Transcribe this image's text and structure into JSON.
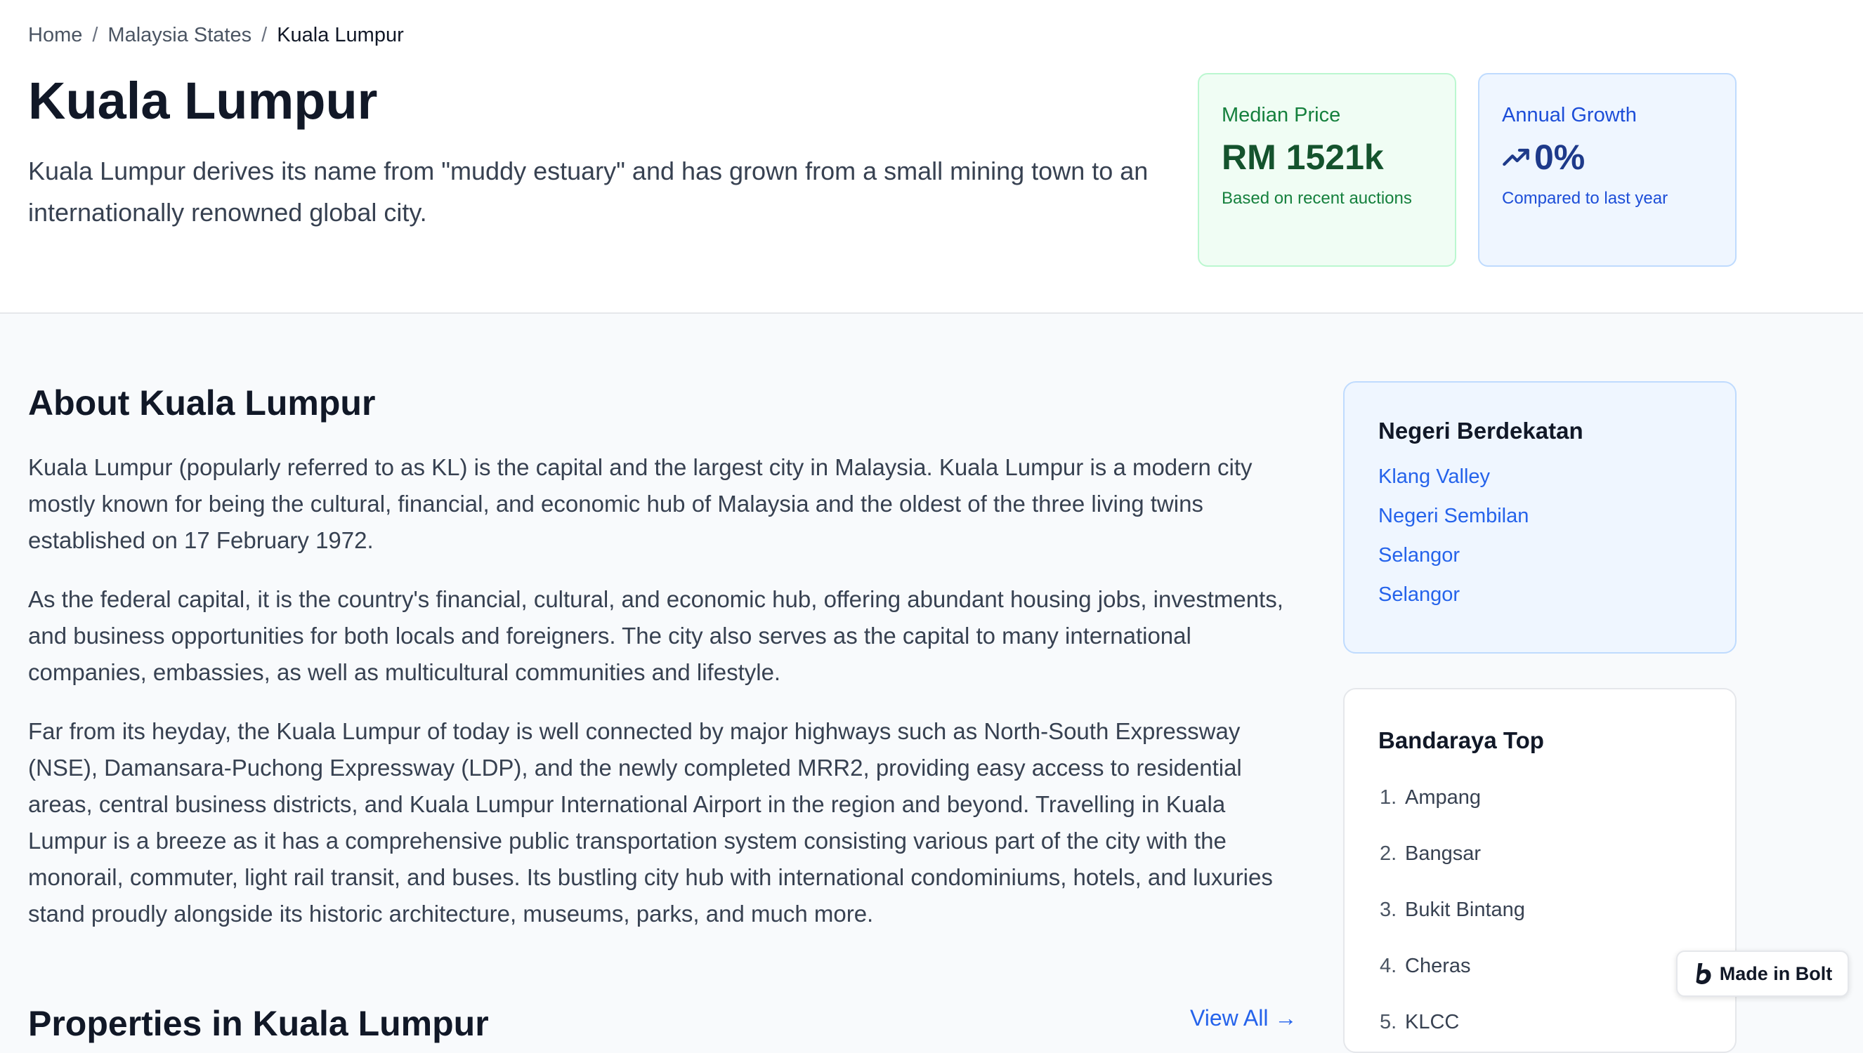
{
  "breadcrumb": {
    "home": "Home",
    "states": "Malaysia States",
    "current": "Kuala Lumpur",
    "separator": "/"
  },
  "header": {
    "title": "Kuala Lumpur",
    "description": "Kuala Lumpur derives its name from \"muddy estuary\" and has grown from a small mining town to an internationally renowned global city."
  },
  "stats": {
    "median": {
      "label": "Median Price",
      "value": "RM 1521k",
      "note": "Based on recent auctions"
    },
    "growth": {
      "label": "Annual Growth",
      "value": "0%",
      "note": "Compared to last year",
      "icon": "trending-up-icon"
    }
  },
  "about": {
    "title": "About Kuala Lumpur",
    "paragraphs": [
      "Kuala Lumpur (popularly referred to as KL) is the capital and the largest city in Malaysia. Kuala Lumpur is a modern city mostly known for being the cultural, financial, and economic hub of Malaysia and the oldest of the three living twins established on 17 February 1972.",
      "As the federal capital, it is the country's financial, cultural, and economic hub, offering abundant housing jobs, investments, and business opportunities for both locals and foreigners. The city also serves as the capital to many international companies, embassies, as well as multicultural communities and lifestyle.",
      "Far from its heyday, the Kuala Lumpur of today is well connected by major highways such as North-South Expressway (NSE), Damansara-Puchong Expressway (LDP), and the newly completed MRR2, providing easy access to residential areas, central business districts, and Kuala Lumpur International Airport in the region and beyond. Travelling in Kuala Lumpur is a breeze as it has a comprehensive public transportation system consisting various part of the city with the monorail, commuter, light rail transit, and buses. Its bustling city hub with international condominiums, hotels, and luxuries stand proudly alongside its historic architecture, museums, parks, and much more."
    ]
  },
  "properties": {
    "title": "Properties in Kuala Lumpur",
    "view_all": "View All →"
  },
  "sidebar": {
    "nearby": {
      "title": "Negeri Berdekatan",
      "items": [
        "Klang Valley",
        "Negeri Sembilan",
        "Selangor",
        "Selangor"
      ]
    },
    "top_cities": {
      "title": "Bandaraya Top",
      "items": [
        {
          "num": "1.",
          "name": "Ampang"
        },
        {
          "num": "2.",
          "name": "Bangsar"
        },
        {
          "num": "3.",
          "name": "Bukit Bintang"
        },
        {
          "num": "4.",
          "name": "Cheras"
        },
        {
          "num": "5.",
          "name": "KLCC"
        }
      ]
    }
  },
  "badge": {
    "label": "Made in Bolt",
    "icon": "bolt-logo-icon"
  },
  "colors": {
    "link": "#2563eb",
    "green_card_bg": "#f0fdf4",
    "blue_card_bg": "#eff6ff",
    "page_bg": "#f8fafc"
  }
}
